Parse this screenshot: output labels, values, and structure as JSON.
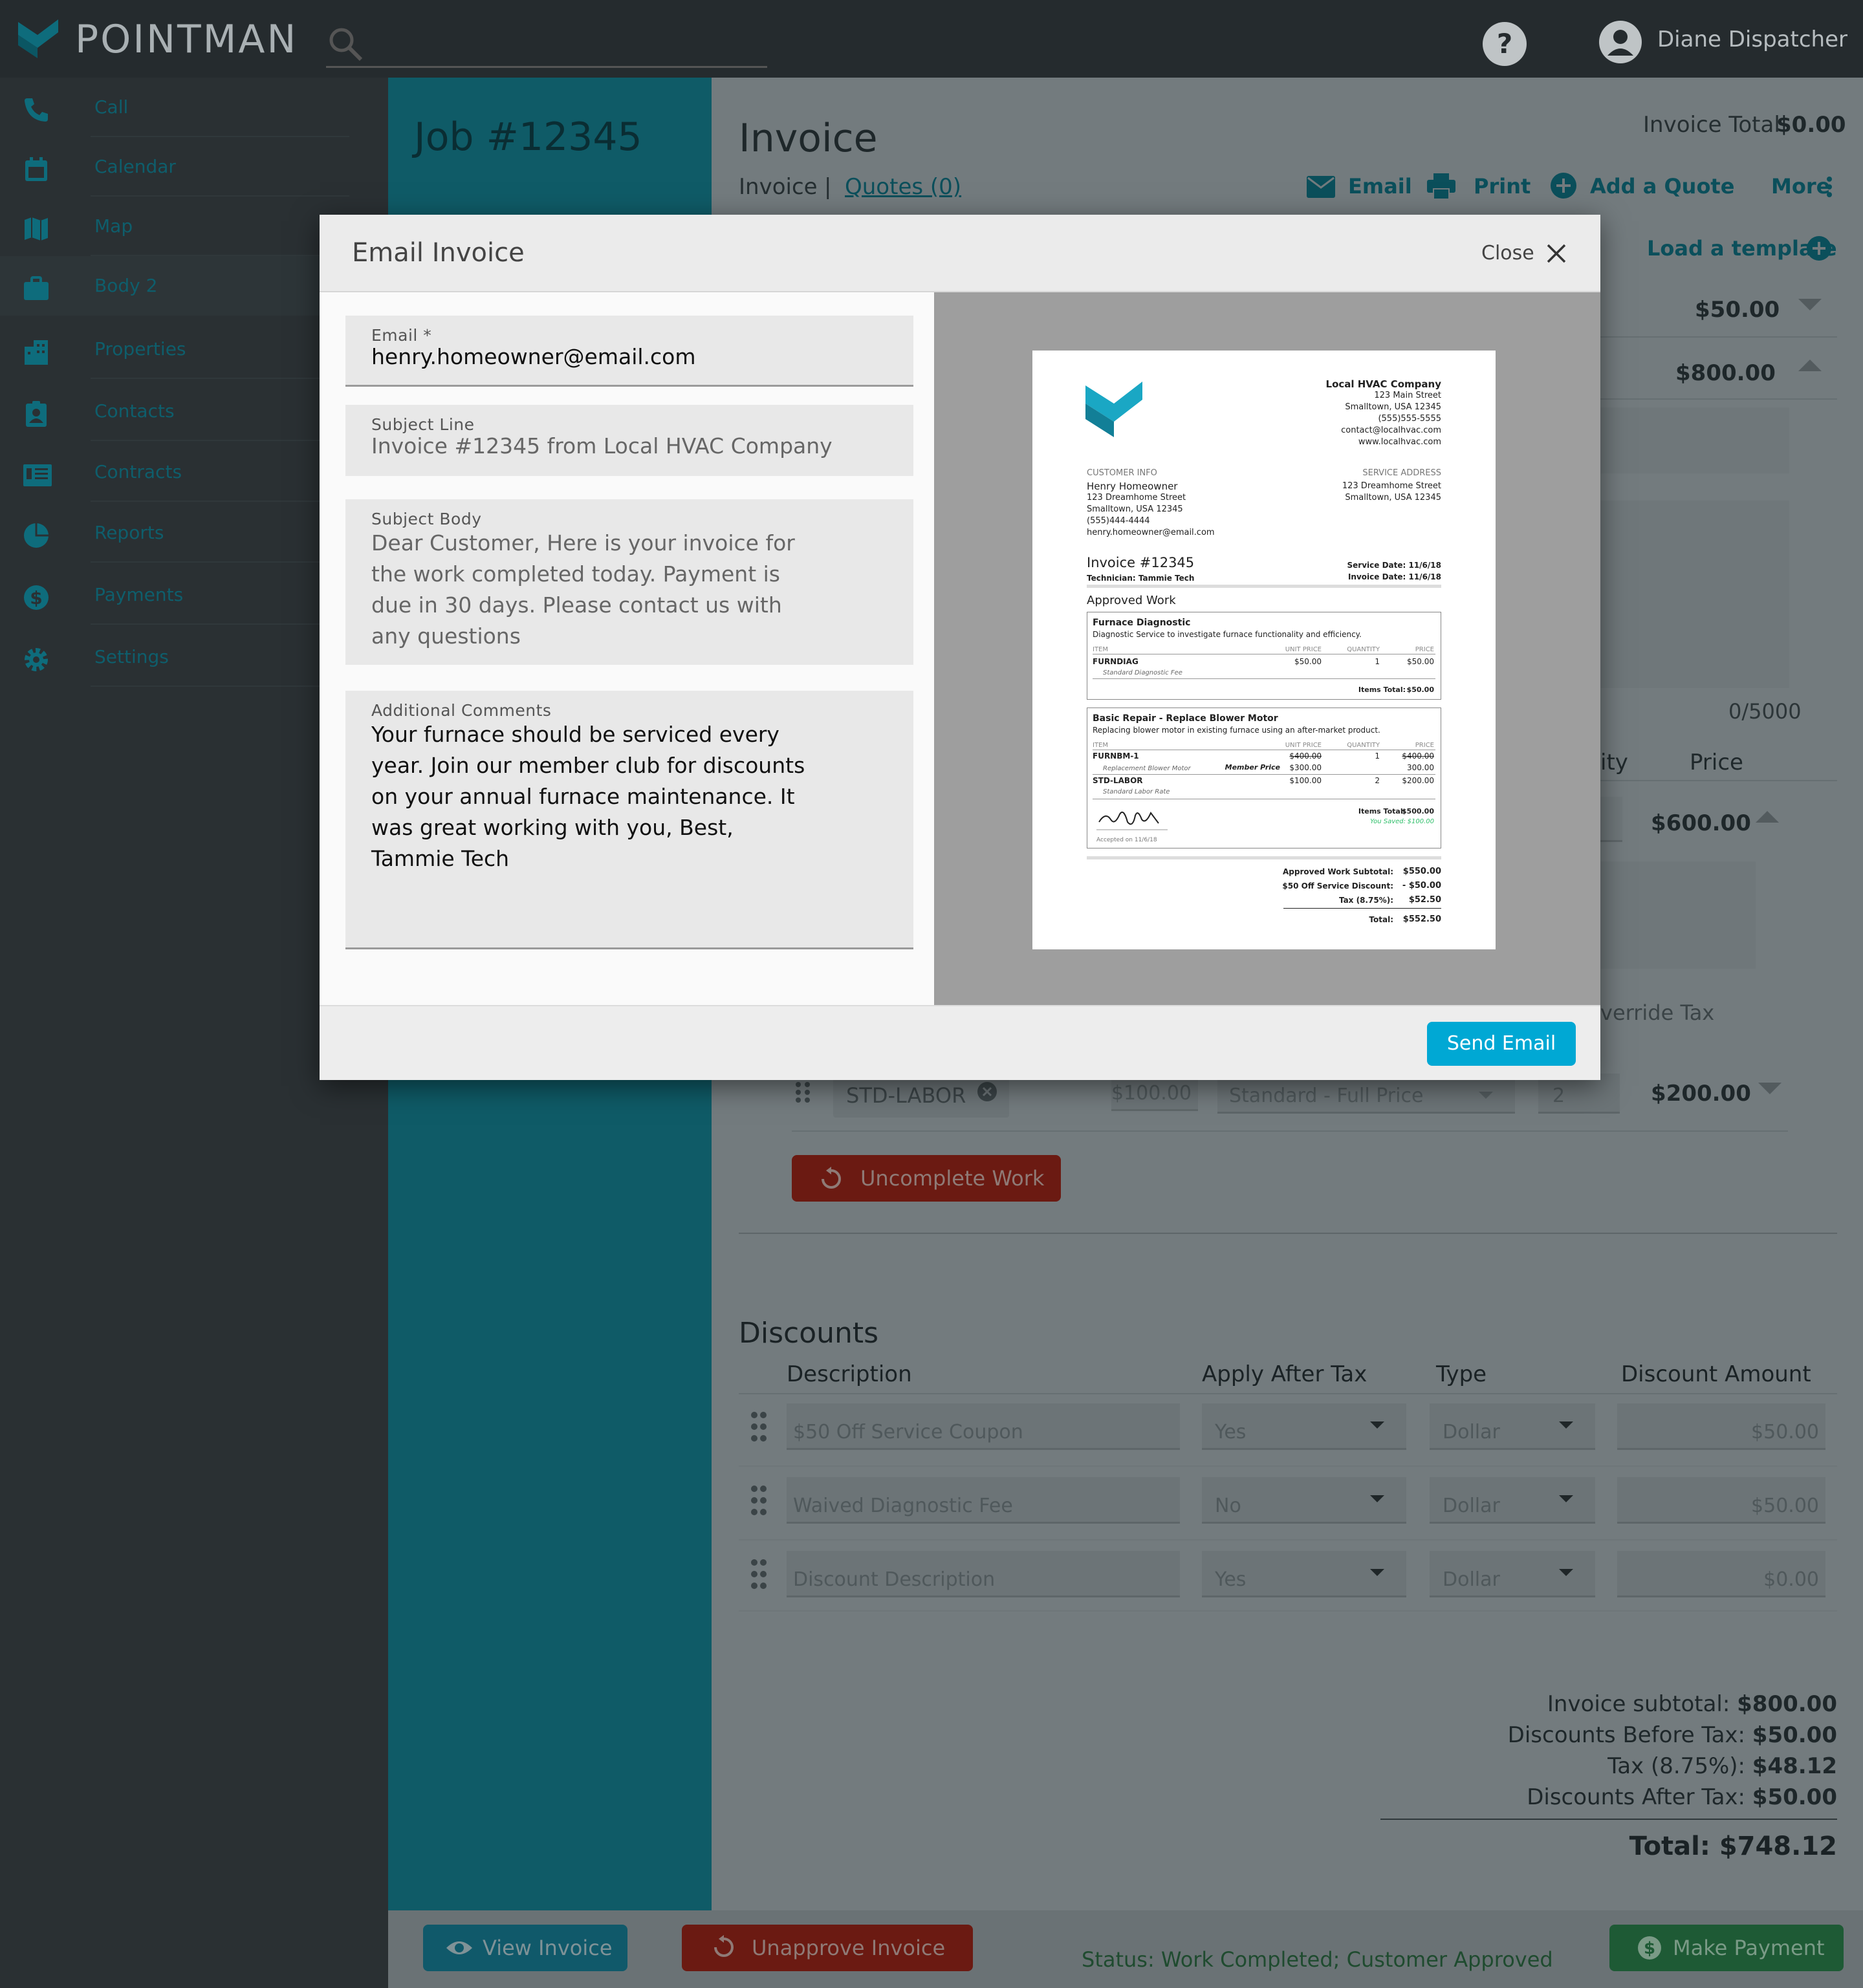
{
  "app": {
    "brand": "POINTMAN",
    "user": "Diane Dispatcher",
    "colors": {
      "accent": "#00a8d4",
      "teal": "#0f5b67",
      "danger": "#6b1a12",
      "success": "#1e5a35"
    }
  },
  "sidebar": {
    "items": [
      {
        "label": "Call",
        "icon": "phone-icon"
      },
      {
        "label": "Calendar",
        "icon": "calendar-icon"
      },
      {
        "label": "Map",
        "icon": "map-icon"
      },
      {
        "label": "Body 2",
        "icon": "briefcase-icon"
      },
      {
        "label": "Properties",
        "icon": "building-icon"
      },
      {
        "label": "Contacts",
        "icon": "contact-badge-icon"
      },
      {
        "label": "Contracts",
        "icon": "contract-icon"
      },
      {
        "label": "Reports",
        "icon": "pie-chart-icon"
      },
      {
        "label": "Payments",
        "icon": "dollar-circle-icon"
      },
      {
        "label": "Settings",
        "icon": "gear-icon"
      }
    ]
  },
  "job": {
    "title": "Job #12345"
  },
  "invoice": {
    "title": "Invoice",
    "total_label": "Invoice Total",
    "total_value": "$0.00",
    "tab_invoice": "Invoice",
    "tab_separator": "|",
    "tab_quotes": "Quotes (0)",
    "actions": {
      "email": "Email",
      "print": "Print",
      "add_quote": "Add a Quote",
      "more": "More"
    },
    "load_template": "Load a template",
    "line1_price": "$50.00",
    "line2_price": "$800.00",
    "char_count": "0/5000",
    "col_quantity_partial": "ity",
    "col_price": "Price",
    "row_price": "$600.00",
    "override_tax_partial": "verride Tax",
    "std_labor": {
      "code": "STD-LABOR",
      "unit": "$100.00",
      "pricing": "Standard - Full Price",
      "qty": "2",
      "price": "$200.00"
    },
    "uncomplete_label": "Uncomplete Work"
  },
  "discounts": {
    "title": "Discounts",
    "headers": [
      "Description",
      "Apply After Tax",
      "Type",
      "Discount Amount"
    ],
    "rows": [
      {
        "description": "$50 Off Service Coupon",
        "after_tax": "Yes",
        "type": "Dollar",
        "amount": "$50.00"
      },
      {
        "description": "Waived Diagnostic Fee",
        "after_tax": "No",
        "type": "Dollar",
        "amount": "$50.00"
      },
      {
        "description": "Discount Description",
        "after_tax": "Yes",
        "type": "Dollar",
        "amount": "$0.00"
      }
    ]
  },
  "totals": {
    "subtotal_label": "Invoice subtotal:",
    "subtotal": "$800.00",
    "before_tax_label": "Discounts Before Tax:",
    "before_tax": "$50.00",
    "tax_label": "Tax (8.75%):",
    "tax": "$48.12",
    "after_tax_label": "Discounts After Tax:",
    "after_tax": "$50.00",
    "total_label": "Total:",
    "total": "$748.12"
  },
  "footer": {
    "view_invoice": "View Invoice",
    "unapprove": "Unapprove Invoice",
    "status": "Status: Work Completed; Customer Approved",
    "make_payment": "Make Payment"
  },
  "modal": {
    "title": "Email Invoice",
    "close": "Close",
    "email_label": "Email *",
    "email_value": "henry.homeowner@email.com",
    "subject_label": "Subject Line",
    "subject_value": "Invoice #12345 from Local HVAC Company",
    "body_label": "Subject Body",
    "body_value": "Dear Customer, Here is your invoice for the work completed today. Payment is due in 30 days. Please contact us with any questions",
    "comments_label": "Additional Comments",
    "comments_value": "Your furnace should be serviced every year. Join our member club for discounts on your annual furnace maintenance. It was great working with you, Best, Tammie Tech",
    "send": "Send Email"
  },
  "preview": {
    "company": "Local HVAC Company",
    "company_lines": [
      "123 Main Street",
      "Smalltown, USA 12345",
      "(555)555-5555",
      "contact@localhvac.com",
      "www.localhvac.com"
    ],
    "customer_info_label": "CUSTOMER INFO",
    "customer_lines": [
      "Henry Homeowner",
      "123 Dreamhome Street",
      "Smalltown, USA 12345",
      "(555)444-4444",
      "henry.homeowner@email.com"
    ],
    "service_address_label": "SERVICE ADDRESS",
    "service_lines": [
      "123 Dreamhome Street",
      "Smalltown, USA 12345"
    ],
    "invoice_number": "Invoice #12345",
    "technician": "Technician:  Tammie Tech",
    "service_date": "Service Date: 11/6/18",
    "invoice_date": "Invoice Date: 11/6/18",
    "approved_work": "Approved Work",
    "col_item": "ITEM",
    "col_unit": "UNIT PRICE",
    "col_qty": "QUANTITY",
    "col_price": "PRICE",
    "section1": {
      "title": "Furnace  Diagnostic",
      "desc": "Diagnostic Service to investigate furnace functionality and efficiency.",
      "code": "FURNDIAG",
      "unit": "$50.00",
      "qty": "1",
      "price": "$50.00",
      "sub": "Standard Diagnostic Fee",
      "items_total_label": "Items Total:",
      "items_total": "$50.00"
    },
    "section2": {
      "title": "Basic Repair - Replace Blower Motor",
      "desc": "Replacing blower motor in existing furnace using an after-market product.",
      "row1": {
        "code": "FURNBM-1",
        "unit_old": "$400.00",
        "qty": "1",
        "price_old": "$400.00",
        "sub": "Replacement Blower Motor",
        "member_label": "Member Price",
        "member_unit": "$300.00",
        "member_price": "300.00"
      },
      "row2": {
        "code": "STD-LABOR",
        "unit": "$100.00",
        "qty": "2",
        "price": "$200.00",
        "sub": "Standard Labor Rate"
      },
      "items_total_label": "Items Total:",
      "items_total": "$500.00",
      "saved_label": "You Saved:",
      "saved": "$100.00",
      "accepted": "Accepted on 11/6/18"
    },
    "summary": [
      {
        "label": "Approved Work Subtotal:",
        "value": "$550.00"
      },
      {
        "label": "$50 Off Service Discount:",
        "value": "- $50.00"
      },
      {
        "label": "Tax (8.75%):",
        "value": "$52.50"
      }
    ],
    "total_label": "Total:",
    "total": "$552.50"
  }
}
